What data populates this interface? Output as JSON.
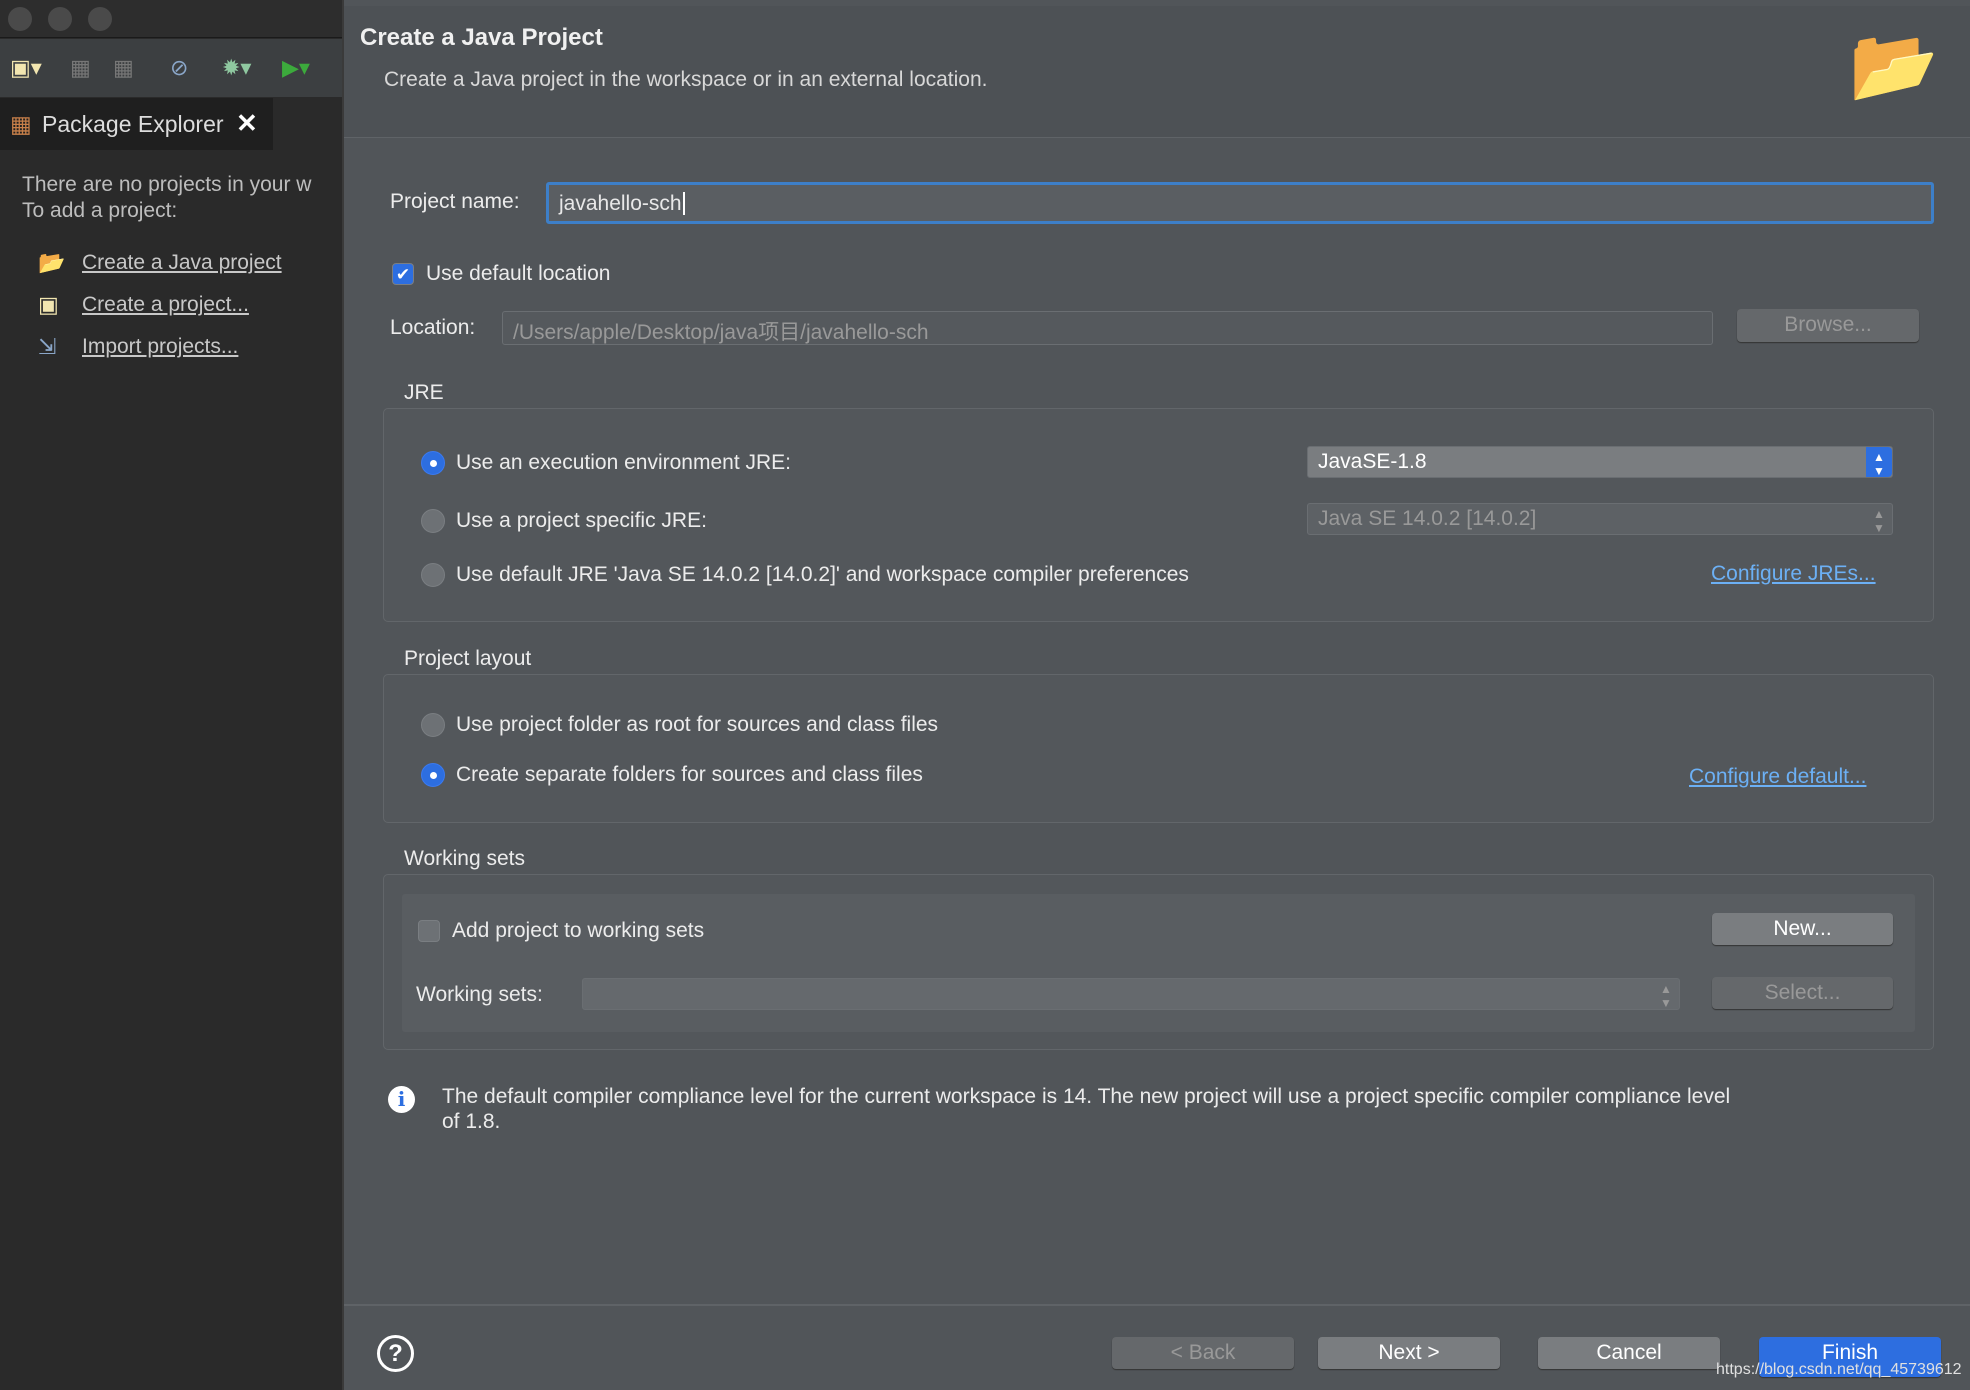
{
  "left": {
    "toolbar_icons": [
      "new-wizard-icon",
      "save-icon",
      "save-all-icon",
      "search-icon",
      "debug-icon",
      "run-icon"
    ],
    "tab_label": "Package Explorer",
    "empty_line1": "There are no projects in your w",
    "empty_line2": "To add a project:",
    "links": [
      "Create a Java project",
      "Create a project...",
      "Import projects..."
    ]
  },
  "dialog": {
    "title": "Create a Java Project",
    "subtitle": "Create a Java project in the workspace or in an external location.",
    "project_name_label": "Project name:",
    "project_name_value": "javahello-sch",
    "use_default_location": "Use default location",
    "location_label": "Location:",
    "location_value": "/Users/apple/Desktop/java项目/javahello-sch",
    "browse": "Browse...",
    "jre": {
      "label": "JRE",
      "opt1": "Use an execution environment JRE:",
      "opt2": "Use a project specific JRE:",
      "opt3": "Use default JRE 'Java SE 14.0.2 [14.0.2]' and workspace compiler preferences",
      "env_value": "JavaSE-1.8",
      "specific_value": "Java SE 14.0.2 [14.0.2]",
      "configure": "Configure JREs..."
    },
    "layout": {
      "label": "Project layout",
      "opt1": "Use project folder as root for sources and class files",
      "opt2": "Create separate folders for sources and class files",
      "configure": "Configure default..."
    },
    "working_sets": {
      "label": "Working sets",
      "add": "Add project to working sets",
      "new": "New...",
      "sets_label": "Working sets:",
      "select": "Select..."
    },
    "info_line1": "The default compiler compliance level for the current workspace is 14. The new project will use a project specific compiler compliance level",
    "info_line2": "of 1.8.",
    "buttons": {
      "back": "< Back",
      "next": "Next >",
      "cancel": "Cancel",
      "finish": "Finish"
    },
    "watermark": "https://blog.csdn.net/qq_45739612",
    "accent": "#2d6ee0"
  }
}
